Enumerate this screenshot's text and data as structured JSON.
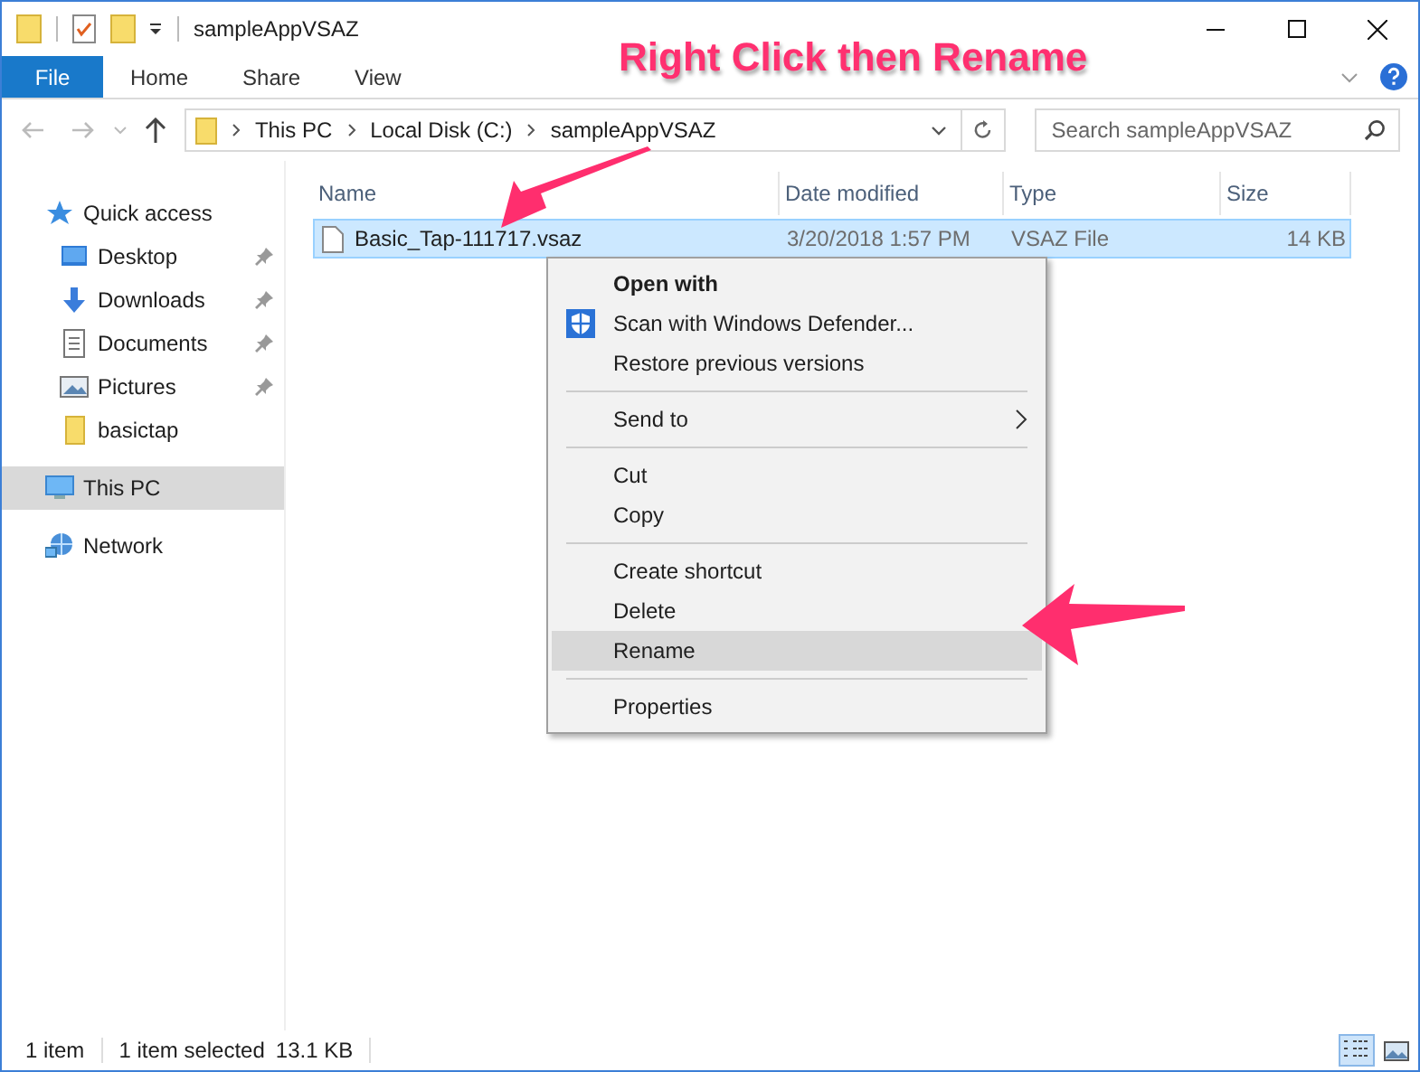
{
  "window": {
    "title": "sampleAppVSAZ"
  },
  "ribbon_tabs": [
    {
      "label": "File",
      "selected": true
    },
    {
      "label": "Home",
      "selected": false
    },
    {
      "label": "Share",
      "selected": false
    },
    {
      "label": "View",
      "selected": false
    }
  ],
  "address_bar": {
    "crumbs": [
      "This PC",
      "Local Disk (C:)",
      "sampleAppVSAZ"
    ]
  },
  "search": {
    "placeholder": "Search sampleAppVSAZ"
  },
  "annotation": {
    "title": "Right Click then Rename"
  },
  "sidebar": {
    "items": [
      {
        "label": "Quick access",
        "selected": false,
        "children": [
          {
            "label": "Desktop",
            "selected": false,
            "pinned": true
          },
          {
            "label": "Downloads",
            "selected": false,
            "pinned": true
          },
          {
            "label": "Documents",
            "selected": false,
            "pinned": true
          },
          {
            "label": "Pictures",
            "selected": false,
            "pinned": true
          },
          {
            "label": "basictap",
            "selected": false,
            "pinned": false
          }
        ]
      },
      {
        "label": "This PC",
        "selected": true
      },
      {
        "label": "Network",
        "selected": false
      }
    ]
  },
  "table": {
    "columns": [
      "Name",
      "Date modified",
      "Type",
      "Size"
    ],
    "rows": [
      {
        "name": "Basic_Tap-111717.vsaz",
        "date": "3/20/2018 1:57 PM",
        "type": "VSAZ File",
        "size": "14 KB",
        "selected": true
      }
    ]
  },
  "context_menu": [
    {
      "kind": "item",
      "label": "Open with",
      "bold": true,
      "selected": false
    },
    {
      "kind": "item",
      "label": "Scan with Windows Defender...",
      "bold": false,
      "selected": false,
      "shield": true
    },
    {
      "kind": "item",
      "label": "Restore previous versions",
      "bold": false,
      "selected": false
    },
    {
      "kind": "separator"
    },
    {
      "kind": "submenu",
      "label": "Send to",
      "bold": false,
      "selected": false
    },
    {
      "kind": "separator"
    },
    {
      "kind": "item",
      "label": "Cut",
      "bold": false,
      "selected": false
    },
    {
      "kind": "item",
      "label": "Copy",
      "bold": false,
      "selected": false
    },
    {
      "kind": "separator"
    },
    {
      "kind": "item",
      "label": "Create shortcut",
      "bold": false,
      "selected": false
    },
    {
      "kind": "item",
      "label": "Delete",
      "bold": false,
      "selected": false
    },
    {
      "kind": "item",
      "label": "Rename",
      "bold": false,
      "selected": true
    },
    {
      "kind": "separator"
    },
    {
      "kind": "item",
      "label": "Properties",
      "bold": false,
      "selected": false
    }
  ],
  "status_bar": {
    "count": "1 item",
    "selection": "1 item selected",
    "size": "13.1 KB"
  }
}
